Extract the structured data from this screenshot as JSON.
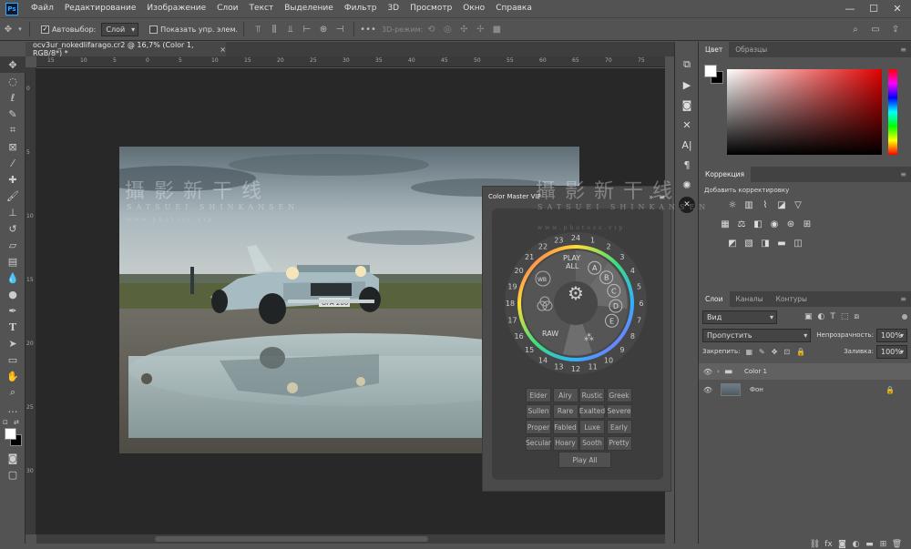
{
  "menubar": {
    "logo": "Ps",
    "items": [
      "Файл",
      "Редактирование",
      "Изображение",
      "Слои",
      "Текст",
      "Выделение",
      "Фильтр",
      "3D",
      "Просмотр",
      "Окно",
      "Справка"
    ],
    "win_min": "—",
    "win_max": "☐",
    "win_close": "✕"
  },
  "options": {
    "autoselect_label": "Автовыбор:",
    "autoselect_value": "Слой",
    "show_transform_label": "Показать упр. элем.",
    "mode3d_label": "3D-режим:"
  },
  "document": {
    "tab_title": "ocv3ur_nokedlifarago.cr2 @ 16,7% (Color 1, RGB/8*) *",
    "close": "×"
  },
  "ruler": {
    "h_ticks": [
      "15",
      "10",
      "5",
      "0",
      "5",
      "10",
      "15",
      "20",
      "25",
      "30",
      "35",
      "40",
      "45",
      "50",
      "55",
      "60",
      "65",
      "70",
      "75"
    ],
    "v_ticks": [
      "0",
      "5",
      "10",
      "15",
      "20",
      "25",
      "30"
    ]
  },
  "watermark": {
    "cn": "攝影新干线",
    "en": "SATSUEI SHINKANSEN",
    "url": "www.photoss.vip"
  },
  "photo": {
    "plate": "UPA 200"
  },
  "color_master": {
    "title": "Color Master VIP",
    "collapse": "»",
    "menu": "≡",
    "close_icon": "✕",
    "play_all_label_1": "PLAY",
    "play_all_label_2": "ALL",
    "raw_label": "RAW",
    "wb_label": "WB",
    "dial_letters": [
      "A",
      "B",
      "C",
      "D",
      "E"
    ],
    "dial_numbers": [
      "1",
      "2",
      "3",
      "4",
      "5",
      "6",
      "7",
      "8",
      "9",
      "10",
      "11",
      "12",
      "13",
      "14",
      "15",
      "16",
      "17",
      "18",
      "19",
      "20",
      "21",
      "22",
      "23",
      "24"
    ],
    "presets": [
      [
        "Elder",
        "Airy",
        "Rustic",
        "Greek"
      ],
      [
        "Sullen",
        "Rare",
        "Exalted",
        "Severe"
      ],
      [
        "Proper",
        "Fabled",
        "Luxe",
        "Early"
      ],
      [
        "Secular",
        "Hoary",
        "Sooth",
        "Pretty"
      ]
    ],
    "play_all_button": "Play All"
  },
  "panels": {
    "color": {
      "tab1": "Цвет",
      "tab2": "Образцы"
    },
    "adjustments": {
      "tab": "Коррекция",
      "add_label": "Добавить корректировку"
    },
    "layers": {
      "tab1": "Слои",
      "tab2": "Каналы",
      "tab3": "Контуры",
      "filter_kind": "Вид",
      "blend_mode": "Пропустить",
      "opacity_label": "Непрозрачность:",
      "opacity_value": "100%",
      "lock_label": "Закрепить:",
      "fill_label": "Заливка:",
      "fill_value": "100%",
      "items": [
        {
          "name": "Color 1",
          "type": "group"
        },
        {
          "name": "Фон",
          "type": "image"
        }
      ]
    }
  },
  "colors": {
    "ps_bg": "#535353",
    "canvas_bg": "#282828",
    "accent_blue": "#31a8ff",
    "selected_layer": "#616161"
  }
}
